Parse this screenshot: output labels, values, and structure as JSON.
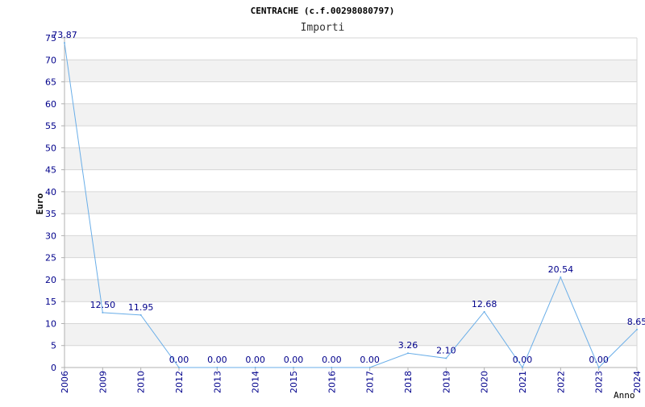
{
  "chart_data": {
    "type": "line",
    "title": "CENTRACHE (c.f.00298080797)",
    "subtitle": "Importi",
    "xlabel": "Anno",
    "ylabel": "Euro",
    "ylim": [
      0,
      75
    ],
    "yticks": [
      0,
      5,
      10,
      15,
      20,
      25,
      30,
      35,
      40,
      45,
      50,
      55,
      60,
      65,
      70,
      75
    ],
    "grid": true,
    "categories": [
      "2006",
      "2009",
      "2010",
      "2012",
      "2013",
      "2014",
      "2015",
      "2016",
      "2017",
      "2018",
      "2019",
      "2020",
      "2021",
      "2022",
      "2023",
      "2024"
    ],
    "series": [
      {
        "values": [
          73.87,
          12.5,
          11.95,
          0.0,
          0.0,
          0.0,
          0.0,
          0.0,
          0.0,
          3.26,
          2.1,
          12.68,
          0.0,
          20.54,
          0.0,
          8.65
        ],
        "data_labels": [
          "73.87",
          "12.50",
          "11.95",
          "0.00",
          "0.00",
          "0.00",
          "0.00",
          "0.00",
          "0.00",
          "3.26",
          "2.10",
          "12.68",
          "0.00",
          "20.54",
          "0.00",
          "8.65"
        ]
      }
    ],
    "colors": {
      "line": "#6aaee8",
      "tick_text": "#00008b",
      "title_text": "#000000",
      "band": "#f2f2f2",
      "gridline": "#d6d6d6",
      "axis": "#b0b0b0"
    }
  }
}
